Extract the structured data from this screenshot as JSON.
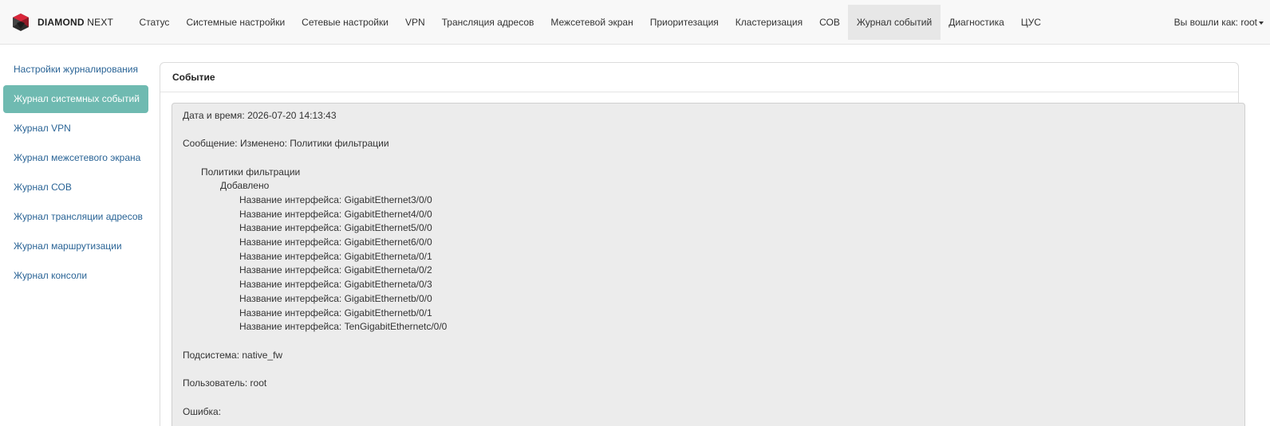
{
  "brand": {
    "name_bold": "DIAMOND",
    "name_rest": "NEXT"
  },
  "nav": {
    "items": [
      "Статус",
      "Системные настройки",
      "Сетевые настройки",
      "VPN",
      "Трансляция адресов",
      "Межсетевой экран",
      "Приоритезация",
      "Кластеризация",
      "СОВ",
      "Журнал событий",
      "Диагностика",
      "ЦУС"
    ],
    "active": "Журнал событий",
    "user_label": "Вы вошли как: root"
  },
  "sidebar": {
    "items": [
      "Настройки журналирования",
      "Журнал системных событий",
      "Журнал VPN",
      "Журнал межсетевого экрана",
      "Журнал СОВ",
      "Журнал трансляции адресов",
      "Журнал маршрутизации",
      "Журнал консоли"
    ],
    "active": "Журнал системных событий"
  },
  "panel": {
    "title": "Событие",
    "datetime": "Дата и время: 2026-07-20 14:13:43",
    "message": "Сообщение: Изменено: Политики фильтрации",
    "section": "Политики фильтрации",
    "action": "Добавлено",
    "interfaces": [
      "Название интерфейса: GigabitEthernet3/0/0",
      "Название интерфейса: GigabitEthernet4/0/0",
      "Название интерфейса: GigabitEthernet5/0/0",
      "Название интерфейса: GigabitEthernet6/0/0",
      "Название интерфейса: GigabitEtherneta/0/1",
      "Название интерфейса: GigabitEtherneta/0/2",
      "Название интерфейса: GigabitEtherneta/0/3",
      "Название интерфейса: GigabitEthernetb/0/0",
      "Название интерфейса: GigabitEthernetb/0/1",
      "Название интерфейса: TenGigabitEthernetc/0/0"
    ],
    "subsystem": "Подсистема: native_fw",
    "user": "Пользователь: root",
    "error": "Ошибка:"
  },
  "colors": {
    "accent": "#6fbab1",
    "link": "#2a6496",
    "logo_red": "#d9263a",
    "logo_dark": "#2b2b2b"
  }
}
